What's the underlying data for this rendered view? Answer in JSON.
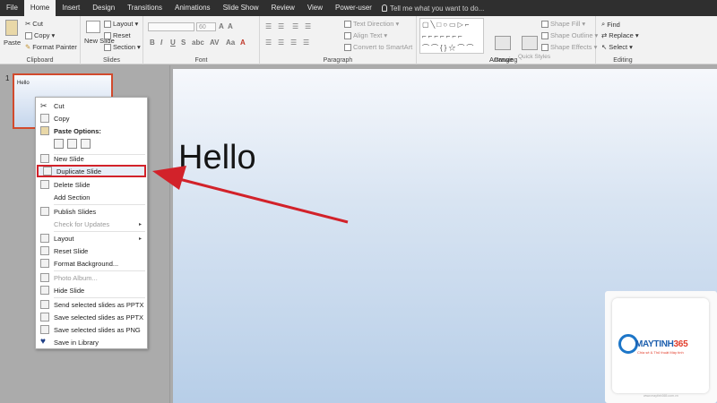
{
  "menu": {
    "tabs": [
      "File",
      "Home",
      "Insert",
      "Design",
      "Transitions",
      "Animations",
      "Slide Show",
      "Review",
      "View",
      "Power-user"
    ],
    "active_tab": "Home",
    "tell_me": "Tell me what you want to do..."
  },
  "ribbon": {
    "clipboard": {
      "label": "Clipboard",
      "paste": "Paste",
      "cut": "Cut",
      "copy": "Copy",
      "format_painter": "Format Painter"
    },
    "slides": {
      "label": "Slides",
      "new_slide": "New Slide",
      "layout": "Layout",
      "reset": "Reset",
      "section": "Section"
    },
    "font": {
      "label": "Font",
      "size": "60"
    },
    "paragraph": {
      "label": "Paragraph",
      "text_direction": "Text Direction",
      "align_text": "Align Text",
      "convert_smartart": "Convert to SmartArt"
    },
    "drawing": {
      "label": "Drawing",
      "arrange": "Arrange",
      "quick_styles": "Quick Styles",
      "shape_fill": "Shape Fill",
      "shape_outline": "Shape Outline",
      "shape_effects": "Shape Effects"
    },
    "editing": {
      "label": "Editing",
      "find": "Find",
      "replace": "Replace",
      "select": "Select"
    }
  },
  "thumbnail": {
    "number": "1",
    "text": "Hello"
  },
  "slide": {
    "title": "Hello"
  },
  "context_menu": {
    "cut": "Cut",
    "copy": "Copy",
    "paste_options": "Paste Options:",
    "new_slide": "New Slide",
    "duplicate_slide": "Duplicate Slide",
    "delete_slide": "Delete Slide",
    "add_section": "Add Section",
    "publish_slides": "Publish Slides",
    "check_updates": "Check for Updates",
    "layout": "Layout",
    "reset_slide": "Reset Slide",
    "format_background": "Format Background...",
    "photo_album": "Photo Album...",
    "hide_slide": "Hide Slide",
    "send_pptx": "Send selected slides as PPTX",
    "save_pptx": "Save selected slides as PPTX",
    "save_png": "Save selected slides as PNG",
    "save_library": "Save in Library"
  },
  "logo": {
    "brand_a": "MAYTINH",
    "brand_b": "365",
    "tagline": "Chia sẻ & Thủ thuật Máy tính",
    "url": "www.maytinh365.com.vn"
  },
  "colors": {
    "highlight": "#d2222a",
    "accent": "#d24a2d",
    "logo_blue": "#1d5fae"
  }
}
